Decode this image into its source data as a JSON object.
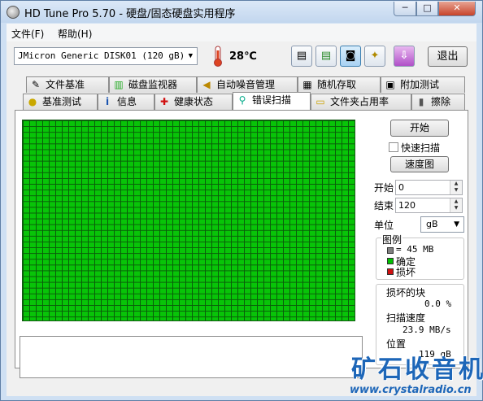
{
  "window": {
    "title": "HD Tune Pro 5.70 - 硬盘/固态硬盘实用程序",
    "min": "─",
    "max": "□",
    "close": "✕"
  },
  "menu": {
    "file": "文件(F)",
    "help": "帮助(H)"
  },
  "toolbar": {
    "drive": "JMicron Generic DISK01 (120 gB)",
    "temperature": "28℃",
    "exit": "退出",
    "icons": [
      "copy-icon",
      "copy-all-icon",
      "camera-icon",
      "settings-icon",
      "save-icon"
    ]
  },
  "tabs_row1": [
    {
      "label": "文件基准",
      "icon": "file-benchmark-icon",
      "glyph": "✎"
    },
    {
      "label": "磁盘监视器",
      "icon": "disk-monitor-icon",
      "glyph": "▥"
    },
    {
      "label": "自动噪音管理",
      "icon": "speaker-icon",
      "glyph": "◀"
    },
    {
      "label": "随机存取",
      "icon": "random-access-icon",
      "glyph": "▦"
    },
    {
      "label": "附加测试",
      "icon": "extra-tests-icon",
      "glyph": "▣"
    }
  ],
  "tabs_row2": [
    {
      "label": "基准测试",
      "icon": "benchmark-icon",
      "glyph": "●"
    },
    {
      "label": "信息",
      "icon": "info-icon",
      "glyph": "i"
    },
    {
      "label": "健康状态",
      "icon": "health-icon",
      "glyph": "✚"
    },
    {
      "label": "错误扫描",
      "icon": "error-scan-icon",
      "glyph": "⚲"
    },
    {
      "label": "文件夹占用率",
      "icon": "folder-icon",
      "glyph": "▭"
    },
    {
      "label": "擦除",
      "icon": "erase-icon",
      "glyph": "▮"
    }
  ],
  "scan": {
    "start_button": "开始",
    "quick_scan": "快速扫描",
    "quick_scan_checked": false,
    "map_button": "速度图",
    "start_label": "开始",
    "start_value": "0",
    "end_label": "结束",
    "end_value": "120",
    "unit_label": "单位",
    "unit_value": "gB",
    "legend_title": "图例",
    "legend": [
      {
        "text": "= 45 MB",
        "color": "#808080"
      },
      {
        "text": "确定",
        "color": "#00c000"
      },
      {
        "text": "损坏",
        "color": "#d01010"
      }
    ],
    "damaged_label": "损坏的块",
    "damaged_value": "0.0 %",
    "speed_label": "扫描速度",
    "speed_value": "23.9 MB/s",
    "position_label": "位置",
    "position_value": "119 gB",
    "grid_color": "#08c408"
  },
  "watermark": {
    "cn": "矿石收音机",
    "url": "www.crystalradio.cn"
  }
}
